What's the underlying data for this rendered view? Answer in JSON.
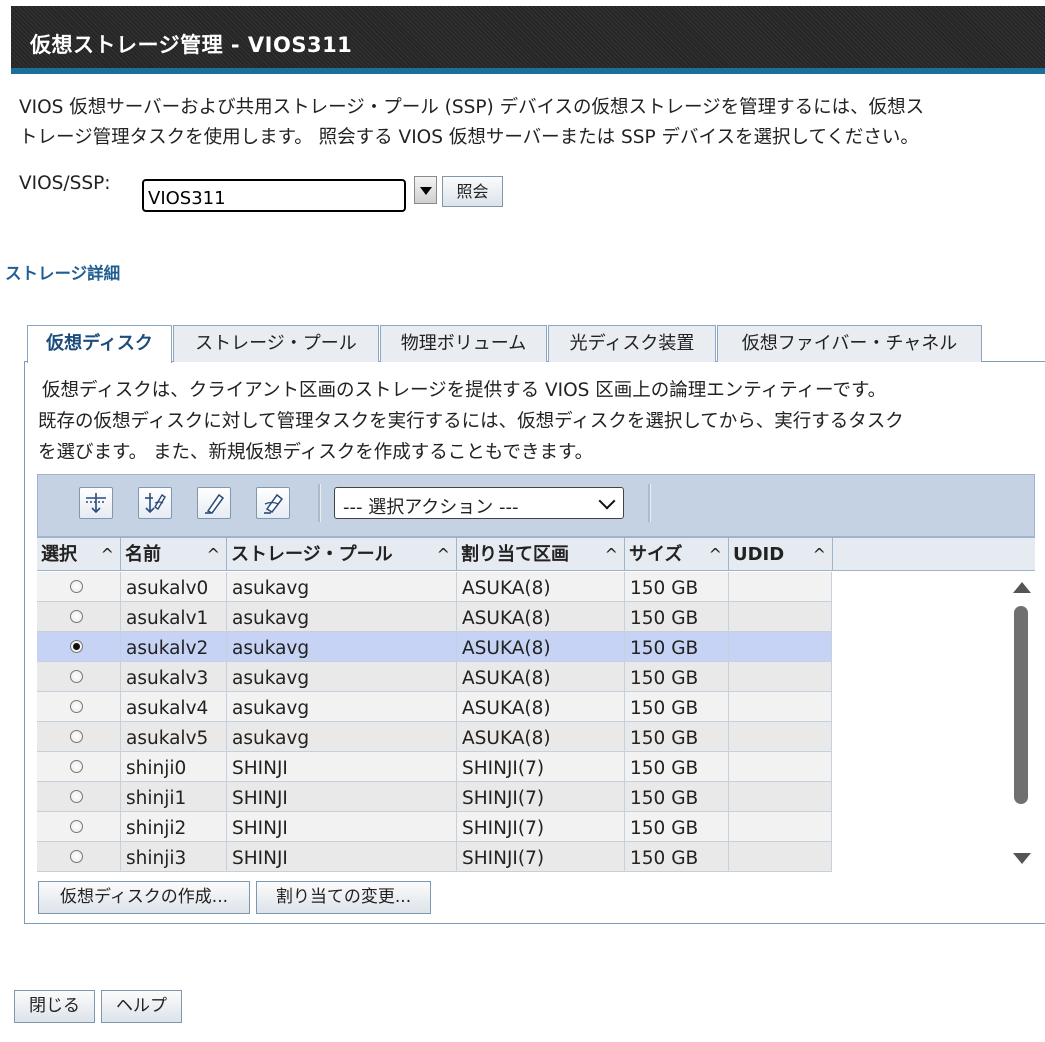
{
  "window": {
    "title": "仮想ストレージ管理 - VIOS311"
  },
  "intro": {
    "line1": "VIOS 仮想サーバーおよび共用ストレージ・プール (SSP) デバイスの仮想ストレージを管理するには、仮想ス",
    "line2": "トレージ管理タスクを使用します。 照会する VIOS 仮想サーバーまたは SSP デバイスを選択してください。"
  },
  "vios": {
    "label": "VIOS/SSP:",
    "value": "VIOS311",
    "query_button": "照会"
  },
  "section": {
    "title": "ストレージ詳細"
  },
  "tabs": [
    {
      "label": "仮想ディスク",
      "active": true
    },
    {
      "label": "ストレージ・プール",
      "active": false
    },
    {
      "label": "物理ボリューム",
      "active": false
    },
    {
      "label": "光ディスク装置",
      "active": false
    },
    {
      "label": "仮想ファイバー・チャネル",
      "active": false
    }
  ],
  "description": {
    "line1": "仮想ディスクは、クライアント区画のストレージを提供する VIOS 区画上の論理エンティティーです。",
    "line2": "既存の仮想ディスクに対して管理タスクを実行するには、仮想ディスクを選択してから、実行するタスク",
    "line3": "を選びます。 また、新規仮想ディスクを作成することもできます。"
  },
  "toolbar": {
    "icons": [
      "select-all-icon",
      "filter-icon",
      "edit-sort-icon",
      "clear-filter-icon"
    ],
    "action_select": "--- 選択アクション ---"
  },
  "table": {
    "columns": [
      "選択",
      "名前",
      "ストレージ・プール",
      "割り当て区画",
      "サイズ",
      "UDID"
    ],
    "sort_indicator": "^",
    "rows": [
      {
        "name": "asukalv0",
        "pool": "asukavg",
        "partition": "ASUKA(8)",
        "size": "150 GB",
        "udid": "",
        "selected": false
      },
      {
        "name": "asukalv1",
        "pool": "asukavg",
        "partition": "ASUKA(8)",
        "size": "150 GB",
        "udid": "",
        "selected": false
      },
      {
        "name": "asukalv2",
        "pool": "asukavg",
        "partition": "ASUKA(8)",
        "size": "150 GB",
        "udid": "",
        "selected": true
      },
      {
        "name": "asukalv3",
        "pool": "asukavg",
        "partition": "ASUKA(8)",
        "size": "150 GB",
        "udid": "",
        "selected": false
      },
      {
        "name": "asukalv4",
        "pool": "asukavg",
        "partition": "ASUKA(8)",
        "size": "150 GB",
        "udid": "",
        "selected": false
      },
      {
        "name": "asukalv5",
        "pool": "asukavg",
        "partition": "ASUKA(8)",
        "size": "150 GB",
        "udid": "",
        "selected": false
      },
      {
        "name": "shinji0",
        "pool": "SHINJI",
        "partition": "SHINJI(7)",
        "size": "150 GB",
        "udid": "",
        "selected": false
      },
      {
        "name": "shinji1",
        "pool": "SHINJI",
        "partition": "SHINJI(7)",
        "size": "150 GB",
        "udid": "",
        "selected": false
      },
      {
        "name": "shinji2",
        "pool": "SHINJI",
        "partition": "SHINJI(7)",
        "size": "150 GB",
        "udid": "",
        "selected": false
      },
      {
        "name": "shinji3",
        "pool": "SHINJI",
        "partition": "SHINJI(7)",
        "size": "150 GB",
        "udid": "",
        "selected": false
      }
    ]
  },
  "panel_buttons": {
    "create": "仮想ディスクの作成...",
    "change": "割り当ての変更..."
  },
  "footer": {
    "close": "閉じる",
    "help": "ヘルプ"
  },
  "colors": {
    "accent": "#1e6e9c",
    "selected_row": "#c6d3f5",
    "header_bar": "#2a2a2a"
  }
}
